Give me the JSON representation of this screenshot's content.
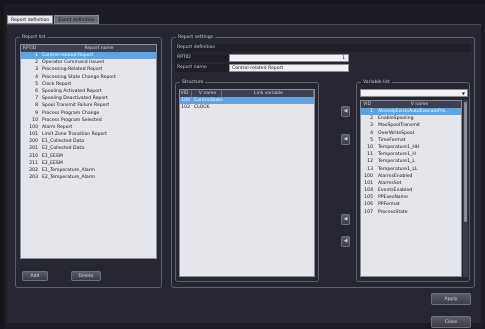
{
  "tabs": [
    {
      "label": "Report definition",
      "active": true
    },
    {
      "label": "Event definition",
      "active": false
    }
  ],
  "report_list": {
    "legend": "Report list",
    "columns": {
      "id": "RPTID",
      "name": "Report name"
    },
    "rows": [
      {
        "id": "1",
        "name": "Control-related Report"
      },
      {
        "id": "2",
        "name": "Operator Command Issued"
      },
      {
        "id": "3",
        "name": "Processing-Related Report"
      },
      {
        "id": "4",
        "name": "Processing State Change Report"
      },
      {
        "id": "5",
        "name": "Clock Report"
      },
      {
        "id": "6",
        "name": "Spooling Activated Report"
      },
      {
        "id": "7",
        "name": "Spooling Deactivated Report"
      },
      {
        "id": "8",
        "name": "Spool Transmit Failure Report"
      },
      {
        "id": "9",
        "name": "Process Program Change"
      },
      {
        "id": "10",
        "name": "Process Program Selected"
      },
      {
        "id": "100",
        "name": "Alarm Report"
      },
      {
        "id": "101",
        "name": "Limit Zone Transition Report"
      },
      {
        "id": "200",
        "name": "E1_Collected Data"
      },
      {
        "id": "201",
        "name": "E2_Collected Data"
      },
      {
        "id": "210",
        "name": "E1_EESM"
      },
      {
        "id": "211",
        "name": "E2_EESM"
      },
      {
        "id": "202",
        "name": "E1_Temperature_Alarm"
      },
      {
        "id": "203",
        "name": "E2_Temperature_Alarm"
      }
    ],
    "selected_index": 0,
    "add_label": "Add",
    "delete_label": "Delete"
  },
  "report_settings": {
    "legend": "Report settings",
    "definition_label": "Report definition",
    "rptid_label": "RPTID",
    "rptid_value": "1",
    "name_label": "Report name",
    "name_value": "Control-related Report",
    "structure": {
      "legend": "Structure",
      "columns": {
        "vid": "VID",
        "vname": "V name",
        "link": "Link variable"
      },
      "rows": [
        {
          "vid": "100",
          "vname": "ControlState",
          "link": ""
        },
        {
          "vid": "102",
          "vname": "CLOCK",
          "link": ""
        }
      ],
      "selected_index": 0
    },
    "variable_list": {
      "legend": "Variable list",
      "columns": {
        "vid": "VID",
        "vname": "V name"
      },
      "rows": [
        {
          "vid": "1",
          "vname": "AlreadyExistsAutoExecutePre..."
        },
        {
          "vid": "2",
          "vname": "EnableSpooling"
        },
        {
          "vid": "3",
          "vname": "MaxSpoolTransmit"
        },
        {
          "vid": "4",
          "vname": "OverWriteSpool"
        },
        {
          "vid": "5",
          "vname": "TimeFormat"
        },
        {
          "vid": "10",
          "vname": "Temperature1_HH"
        },
        {
          "vid": "11",
          "vname": "Temperature1_H"
        },
        {
          "vid": "12",
          "vname": "Temperature1_L"
        },
        {
          "vid": "13",
          "vname": "Temperature1_LL"
        },
        {
          "vid": "100",
          "vname": "AlarmsEnabled"
        },
        {
          "vid": "101",
          "vname": "AlarmsSet"
        },
        {
          "vid": "104",
          "vname": "EventsEnabled"
        },
        {
          "vid": "105",
          "vname": "PPExecName"
        },
        {
          "vid": "106",
          "vname": "PPFormat"
        },
        {
          "vid": "107",
          "vname": "ProcessState"
        }
      ],
      "selected_index": 0
    }
  },
  "apply_label": "Apply",
  "close_label": "Close",
  "arrow_glyph": "◀",
  "dropdown_glyph": "▼"
}
